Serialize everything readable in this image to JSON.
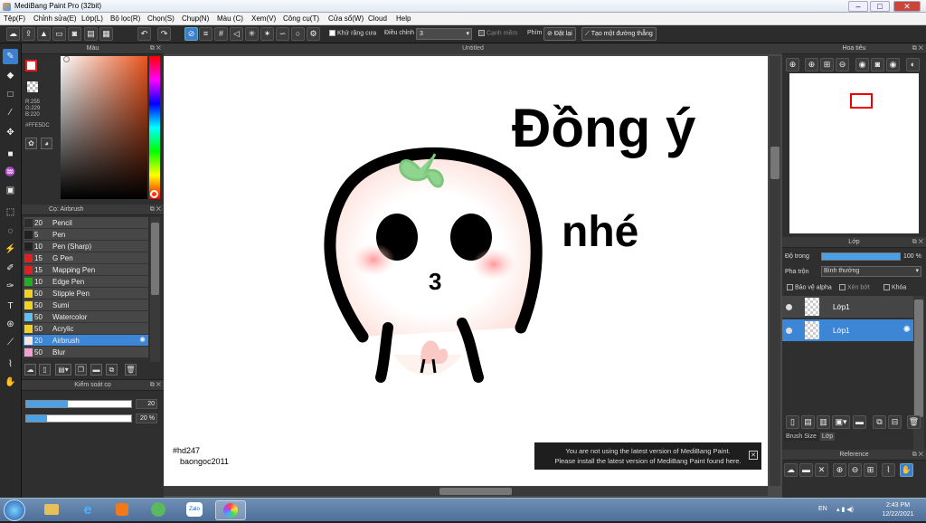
{
  "window": {
    "title": "MediBang Paint Pro (32bit)",
    "minimize": "–",
    "maximize": "□",
    "close": "✕"
  },
  "menu": [
    "Tệp(F)",
    "Chỉnh sửa(E)",
    "Lớp(L)",
    "Bộ lọc(R)",
    "Chọn(S)",
    "Chụp(N)",
    "Màu (C)",
    "Xem(V)",
    "Công cụ(T)",
    "Cửa sổ(W)",
    "Cloud",
    "Help"
  ],
  "toolbar": {
    "antialias_label": "Khử răng cưa",
    "adjust_label": "Điều chỉnh",
    "adjust_value": "3",
    "edge_label": "Cạnh mềm",
    "key_label": "Phím",
    "reset_label": "Đặt lại",
    "straight_line_label": "Tạo một đường thẳng"
  },
  "color_panel": {
    "title": "Màu",
    "r": "R:255",
    "g": "G:229",
    "b": "B:220",
    "hex": "#FFE5DC",
    "accent": "#e8541e"
  },
  "brush_panel": {
    "title": "Cọ: Airbrush",
    "brushes": [
      {
        "size": "20",
        "name": "Pencil",
        "color": "#2d2d2d"
      },
      {
        "size": "5",
        "name": "Pen",
        "color": "#222222"
      },
      {
        "size": "10",
        "name": "Pen (Sharp)",
        "color": "#222222"
      },
      {
        "size": "15",
        "name": "G Pen",
        "color": "#e02020"
      },
      {
        "size": "15",
        "name": "Mapping Pen",
        "color": "#e02020"
      },
      {
        "size": "10",
        "name": "Edge Pen",
        "color": "#20b020"
      },
      {
        "size": "50",
        "name": "Stipple Pen",
        "color": "#f0d020"
      },
      {
        "size": "50",
        "name": "Sumi",
        "color": "#f0d020"
      },
      {
        "size": "50",
        "name": "Watercolor",
        "color": "#60c0f0"
      },
      {
        "size": "50",
        "name": "Acrylic",
        "color": "#f0d020"
      },
      {
        "size": "20",
        "name": "Airbrush",
        "color": "#ffe5dc"
      },
      {
        "size": "50",
        "name": "Blur",
        "color": "#f0a0d0"
      }
    ]
  },
  "brush_control": {
    "title": "Kiểm soát cọ",
    "size_value": "20",
    "size_level": 0.4,
    "opacity_value": "20 %",
    "opacity_level": 0.2
  },
  "document": {
    "tab": "Untitled",
    "sig_line1": "#hd247",
    "sig_line2": "baongoc2011",
    "drawn_text_1": "Đồng ý",
    "drawn_text_2": "nhé",
    "drawn_mouth": "3"
  },
  "notice": {
    "line1": "You are not using the latest version of MediBang Paint.",
    "line2": "Please install the latest version of MediBang Paint found here."
  },
  "navigator": {
    "title": "Hoa tiêu"
  },
  "layer_panel": {
    "title": "Lớp",
    "opacity_label": "Độ trong",
    "opacity_value": "100 %",
    "blend_label": "Pha trộn",
    "blend_value": "Bình thường",
    "protect_alpha": "Bảo vệ alpha",
    "clipping": "Xén bớt",
    "lock": "Khóa",
    "layers": [
      {
        "name": "Lớp1",
        "selected": false
      },
      {
        "name": "Lớp1",
        "selected": true
      }
    ],
    "tab_brush_size": "Brush Size",
    "tab_layer": "Lớp"
  },
  "reference": {
    "title": "Reference"
  },
  "taskbar": {
    "lang": "EN",
    "time": "2:43 PM",
    "date": "12/22/2021",
    "zalo": "Zalo"
  }
}
